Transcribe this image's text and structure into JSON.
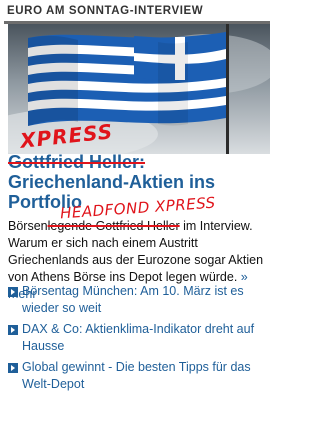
{
  "section": {
    "title": "EURO AM SONNTAG-INTERVIEW"
  },
  "image": {
    "subject": "greek-flag-photo"
  },
  "article": {
    "headline_struck": "Gottfried Heller:",
    "headline_main": "Griechenland-Aktien ins Portfolio",
    "teaser_lead_struck": "Börsenlegende Gottfried Heller",
    "teaser_lead_prefix": "Börsen",
    "teaser_lead_rest": "legende Gottfried Heller",
    "teaser_body": " im Interview. Warum er sich nach einem Austritt Griechenlands aus der Eurozone sogar Aktien von Athens Börse ins Depot legen würde.",
    "more_link": "» mehr"
  },
  "annotations": {
    "xpress": "XPRESS",
    "headfond": "HEADFOND XPRESS"
  },
  "related_links": [
    {
      "label": "Börsentag München: Am 10. März ist es wieder so weit"
    },
    {
      "label": "DAX & Co: Aktienklima-Indikator dreht auf Hausse"
    },
    {
      "label": "Global gewinnt - Die besten Tipps für das Welt-Depot"
    }
  ],
  "colors": {
    "link_blue": "#1f5f99",
    "scribble_red": "#e0141b",
    "flag_blue": "#1c5fb4"
  }
}
